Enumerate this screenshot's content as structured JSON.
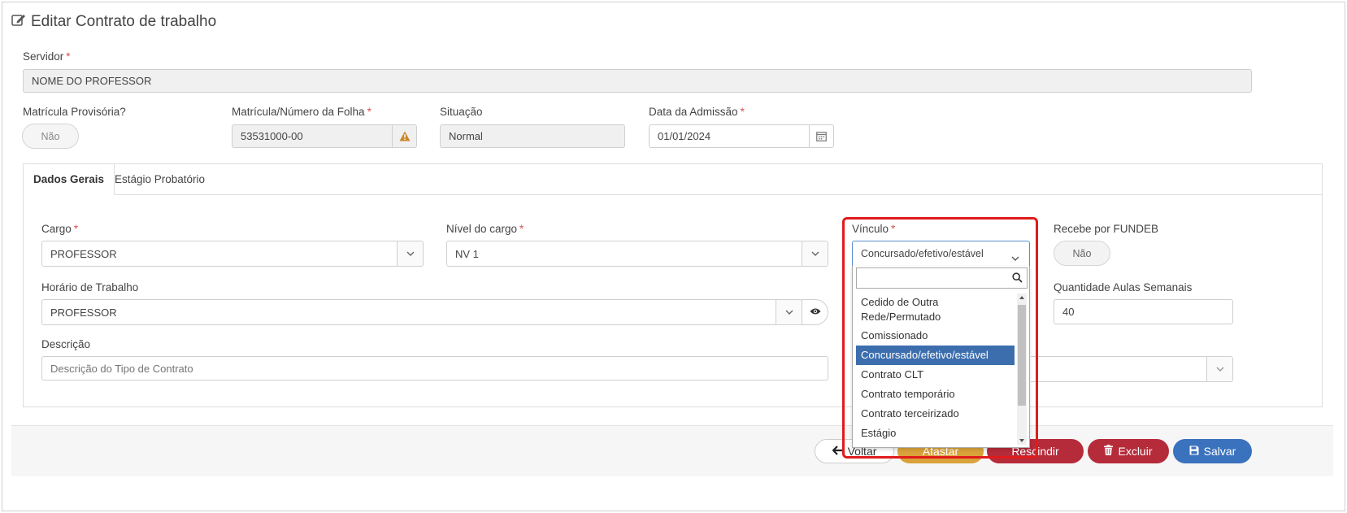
{
  "page": {
    "title": "Editar Contrato de trabalho"
  },
  "servidor": {
    "label": "Servidor",
    "value": "NOME DO PROFESSOR"
  },
  "matricula_provisoria": {
    "label": "Matrícula Provisória?",
    "toggle": "Não"
  },
  "matricula": {
    "label": "Matrícula/Número da Folha",
    "value": "53531000-00"
  },
  "situacao": {
    "label": "Situação",
    "value": "Normal"
  },
  "admissao": {
    "label": "Data da Admissão",
    "value": "01/01/2024"
  },
  "tabs": [
    {
      "label": "Dados Gerais",
      "active": true
    },
    {
      "label": "Estágio Probatório",
      "active": false
    }
  ],
  "cargo": {
    "label": "Cargo",
    "value": "PROFESSOR"
  },
  "nivel": {
    "label": "Nível do cargo",
    "value": "NV 1"
  },
  "vinculo": {
    "label": "Vínculo",
    "value": "Concursado/efetivo/estável",
    "options": [
      "Cedido de Outra Rede/Permutado",
      "Comissionado",
      "Concursado/efetivo/estável",
      "Contrato CLT",
      "Contrato temporário",
      "Contrato terceirizado",
      "Estágio"
    ]
  },
  "fundeb": {
    "label": "Recebe por FUNDEB",
    "toggle": "Não"
  },
  "horario": {
    "label": "Horário de Trabalho",
    "value": "PROFESSOR"
  },
  "aulas": {
    "label": "Quantidade Aulas Semanais",
    "value": "40"
  },
  "descricao": {
    "label": "Descrição",
    "placeholder": "Descrição do Tipo de Contrato"
  },
  "buttons": {
    "voltar": "Voltar",
    "afastar": "Afastar",
    "rescindir": "Rescindir",
    "excluir": "Excluir",
    "salvar": "Salvar"
  },
  "colors": {
    "selected_option": "#3c6eae",
    "salvar": "#3a72bd",
    "excluir": "#b52b3a",
    "rescindir": "#b52b3a",
    "afastar": "#d9a23a",
    "highlight": "#e01b1b",
    "required": "#d9534f"
  },
  "icons": [
    "edit-icon",
    "warning-icon",
    "calendar-icon",
    "chevron-down-icon",
    "eye-icon",
    "search-icon",
    "arrow-left-icon",
    "trash-icon",
    "save-icon"
  ]
}
